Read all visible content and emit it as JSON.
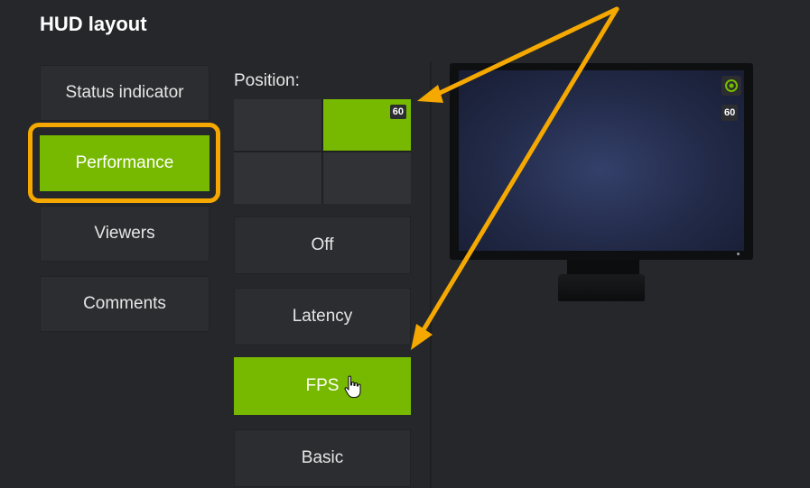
{
  "page": {
    "title": "HUD layout"
  },
  "categories": [
    {
      "label": "Status indicator",
      "active": false
    },
    {
      "label": "Performance",
      "active": true
    },
    {
      "label": "Viewers",
      "active": false
    },
    {
      "label": "Comments",
      "active": false
    }
  ],
  "position": {
    "label": "Position:",
    "selected": "top-right",
    "badge": "60"
  },
  "modes": [
    {
      "label": "Off",
      "active": false
    },
    {
      "label": "Latency",
      "active": false
    },
    {
      "label": "FPS",
      "active": true
    },
    {
      "label": "Basic",
      "active": false
    }
  ],
  "preview": {
    "fps_badge": "60",
    "status_icon": "status-indicator-icon"
  },
  "colors": {
    "accent": "#76b900",
    "annotation": "#f5a800",
    "background": "#25272a"
  }
}
